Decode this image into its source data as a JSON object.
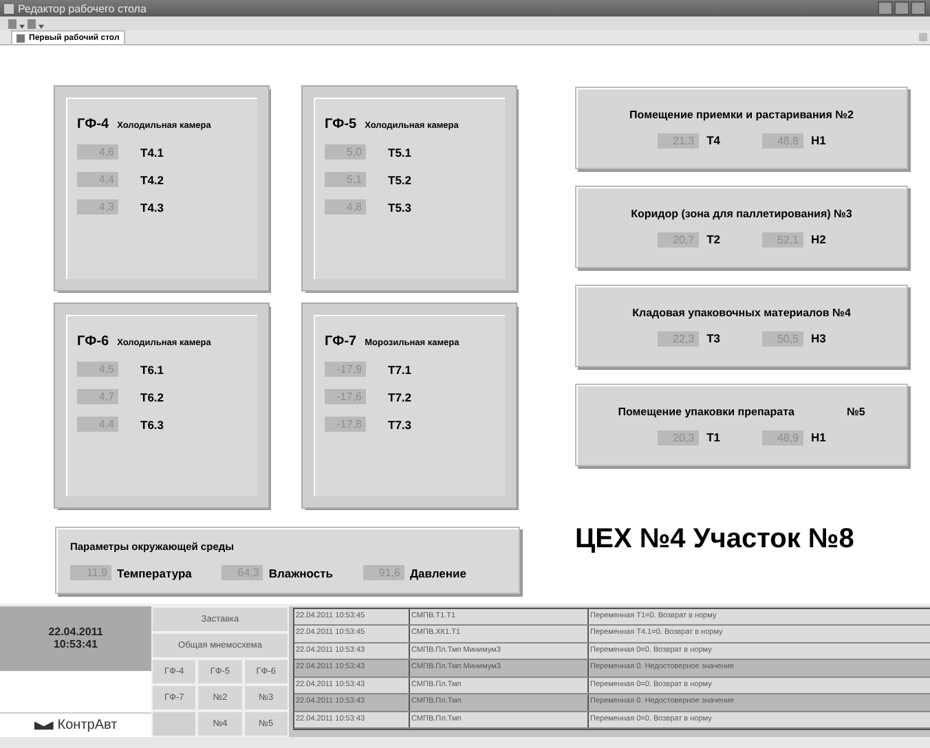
{
  "window": {
    "title": "Редактор рабочего стола"
  },
  "tabs": [
    {
      "label": "Первый рабочий стол",
      "selected": true
    }
  ],
  "chambers": [
    {
      "code": "ГФ-4",
      "title": "Холодильная камера",
      "readings": [
        {
          "value": "4,6",
          "label": "Т4.1"
        },
        {
          "value": "4,4",
          "label": "Т4.2"
        },
        {
          "value": "4,3",
          "label": "Т4.3"
        }
      ]
    },
    {
      "code": "ГФ-5",
      "title": "Холодильная камера",
      "readings": [
        {
          "value": "5,0",
          "label": "Т5.1"
        },
        {
          "value": "5,1",
          "label": "Т5.2"
        },
        {
          "value": "4,8",
          "label": "Т5.3"
        }
      ]
    },
    {
      "code": "ГФ-6",
      "title": "Холодильная камера",
      "readings": [
        {
          "value": "4,5",
          "label": "Т6.1"
        },
        {
          "value": "4,7",
          "label": "Т6.2"
        },
        {
          "value": "4,4",
          "label": "Т6.3"
        }
      ]
    },
    {
      "code": "ГФ-7",
      "title": "Морозильная камера",
      "readings": [
        {
          "value": "-17,9",
          "label": "Т7.1"
        },
        {
          "value": "-17,6",
          "label": "Т7.2"
        },
        {
          "value": "-17,8",
          "label": "Т7.3"
        }
      ]
    }
  ],
  "rooms": [
    {
      "title": "Помещение приемки и растаривания №2",
      "readings": [
        {
          "value": "21,3",
          "label": "Т4"
        },
        {
          "value": "48,8",
          "label": "Н1"
        }
      ]
    },
    {
      "title": "Коридор (зона для паллетирования) №3",
      "readings": [
        {
          "value": "20,7",
          "label": "Т2"
        },
        {
          "value": "52,1",
          "label": "Н2"
        }
      ]
    },
    {
      "title": "Кладовая упаковочных материалов №4",
      "readings": [
        {
          "value": "22,3",
          "label": "Т3"
        },
        {
          "value": "50,5",
          "label": "Н3"
        }
      ]
    },
    {
      "title": "Помещение упаковки препарата",
      "tag": "№5",
      "readings": [
        {
          "value": "20,3",
          "label": "Т1"
        },
        {
          "value": "48,9",
          "label": "Н1"
        }
      ]
    }
  ],
  "environment": {
    "title": "Параметры окружающей среды",
    "readings": [
      {
        "value": "11,9",
        "label": "Температура"
      },
      {
        "value": "64,3",
        "label": "Влажность"
      },
      {
        "value": "91,6",
        "label": "Давление"
      }
    ]
  },
  "heading": "ЦЕХ №4 Участок №8",
  "footer": {
    "date": "22.04.2011",
    "time": "10:53:41",
    "logo": "КонтрАвт",
    "nav_rows": [
      [
        "Заставка"
      ],
      [
        "Общая мнемосхема"
      ],
      [
        "ГФ-4",
        "ГФ-5",
        "ГФ-6"
      ],
      [
        "ГФ-7",
        "№2",
        "№3"
      ],
      [
        "№4",
        "№5"
      ]
    ],
    "log": [
      {
        "time": "22.04.2011 10:53:45",
        "source": "СМПВ.Т1.Т1",
        "message": "Переменная Т1=0. Возврат в норму",
        "alert": false
      },
      {
        "time": "22.04.2011 10:53:45",
        "source": "СМПВ.ХК1.Т1",
        "message": "Переменная Т4.1=0. Возврат в норму",
        "alert": false
      },
      {
        "time": "22.04.2011 10:53:43",
        "source": "СМПВ.Пл.Тмп Минимум3",
        "message": "Переменная 0=0. Возврат в норму",
        "alert": false
      },
      {
        "time": "22.04.2011 10:53:43",
        "source": "СМПВ.Пл.Тмп Минимум3",
        "message": "Переменная 0. Недостоверное значение",
        "alert": true
      },
      {
        "time": "22.04.2011 10:53:43",
        "source": "СМПВ.Пл.Тмп",
        "message": "Переменная 0=0. Возврат в норму",
        "alert": false
      },
      {
        "time": "22.04.2011 10:53:43",
        "source": "СМПВ.Пл.Тмп",
        "message": "Переменная 0. Недостоверное значение",
        "alert": true
      },
      {
        "time": "22.04.2011 10:53:43",
        "source": "СМПВ.Пл.Тмп",
        "message": "Переменная 0=0. Возврат в норму",
        "alert": false
      }
    ]
  }
}
